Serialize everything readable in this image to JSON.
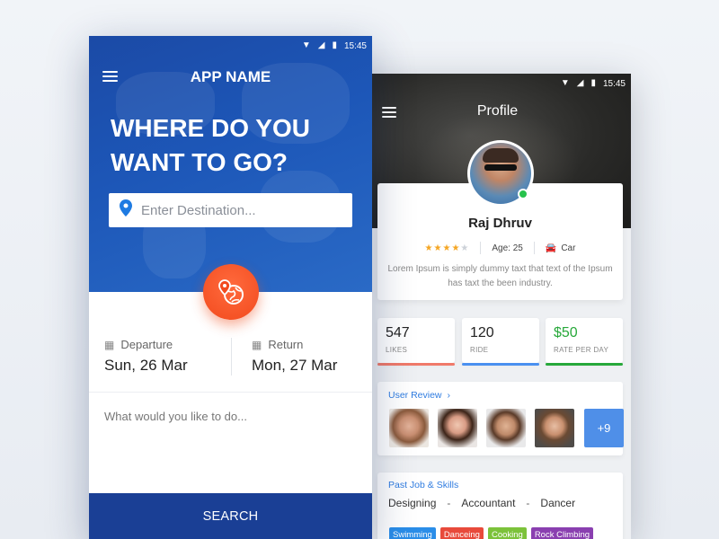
{
  "search_screen": {
    "status": {
      "time": "15:45"
    },
    "app_name": "APP NAME",
    "headline_line1": "WHERE DO YOU",
    "headline_line2": "WANT TO GO?",
    "destination": {
      "placeholder": "Enter Destination...",
      "value": ""
    },
    "departure": {
      "label": "Departure",
      "value": "Sun, 26 Mar"
    },
    "return": {
      "label": "Return",
      "value": "Mon, 27 Mar"
    },
    "activity": {
      "placeholder": "What would you like to do...",
      "value": ""
    },
    "search_label": "SEARCH"
  },
  "profile_screen": {
    "status": {
      "time": "15:45"
    },
    "title": "Profile",
    "name": "Raj Dhruv",
    "rating": 4,
    "rating_max": 5,
    "age": "Age: 25",
    "vehicle": "Car",
    "description": "Lorem Ipsum is simply dummy taxt that text of the Ipsum has taxt  the been industry.",
    "stats": [
      {
        "value": "547",
        "label": "LIKES",
        "color": "#f07a6a"
      },
      {
        "value": "120",
        "label": "RIDE",
        "color": "#4a90f0"
      },
      {
        "value": "$50",
        "label": "RATE PER DAY",
        "color": "#27a83a"
      }
    ],
    "reviews": {
      "title": "User Review",
      "more": "+9"
    },
    "skills": {
      "title": "Past Job & Skills",
      "jobs": [
        "Designing",
        "Accountant",
        "Dancer"
      ],
      "separator": "-",
      "tags": [
        {
          "label": "Swimming",
          "color": "#2a8de8"
        },
        {
          "label": "Danceing",
          "color": "#e84a3b"
        },
        {
          "label": "Cooking",
          "color": "#7cc23a"
        },
        {
          "label": "Rock Climbing",
          "color": "#8a3fb0"
        }
      ]
    }
  }
}
